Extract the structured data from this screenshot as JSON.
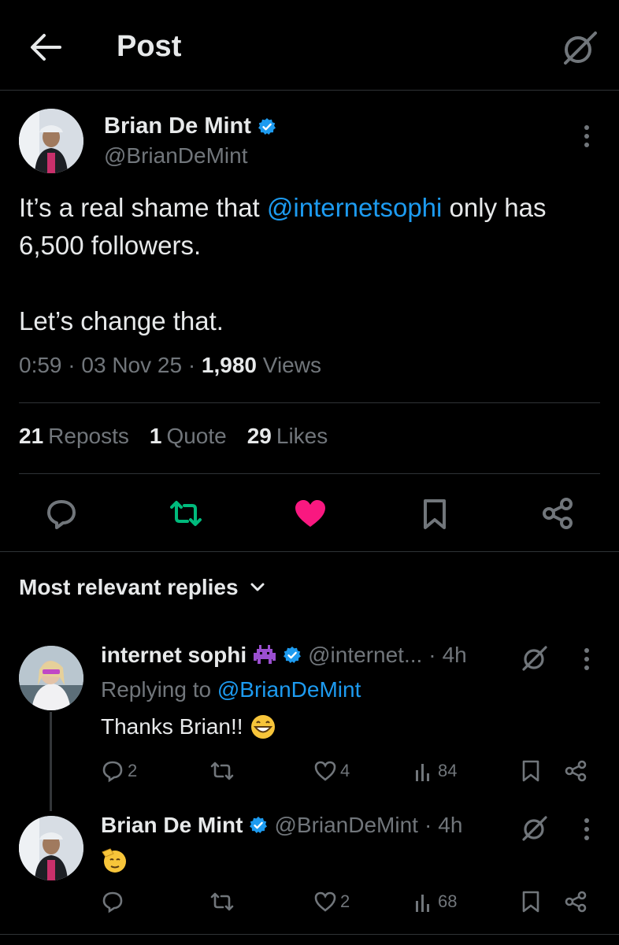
{
  "header": {
    "title": "Post"
  },
  "main_tweet": {
    "author_name": "Brian De Mint",
    "author_handle": "@BrianDeMint",
    "text_part1": "It’s a real shame that ",
    "mention": "@internetsophi",
    "text_part2": " only has 6,500 followers.",
    "text_line3": "Let’s change that.",
    "time": "0:59",
    "date": "03 Nov 25",
    "views_count": "1,980",
    "views_label": "Views",
    "separator": "·"
  },
  "stats": {
    "reposts_count": "21",
    "reposts_label": "Reposts",
    "quotes_count": "1",
    "quotes_label": "Quote",
    "likes_count": "29",
    "likes_label": "Likes"
  },
  "colors": {
    "accent": "#1d9bf0",
    "repost_active": "#00ba7c",
    "like_active": "#f91880",
    "secondary": "#71767b"
  },
  "sort": {
    "label": "Most relevant replies"
  },
  "replies": [
    {
      "author_name": "internet sophi",
      "author_handle": "@internet...",
      "separator": "·",
      "time": "4h",
      "replying_prefix": "Replying to ",
      "replying_to": "@BrianDeMint",
      "text": "Thanks Brian!!",
      "emoji": "grinning-face-emoji",
      "reply_count": "2",
      "repost_count": "",
      "like_count": "4",
      "view_count": "84"
    },
    {
      "author_name": "Brian De Mint",
      "author_handle": "@BrianDeMint",
      "separator": "·",
      "time": "4h",
      "text": "",
      "emoji": "saluting-face-emoji",
      "reply_count": "",
      "repost_count": "",
      "like_count": "2",
      "view_count": "68"
    }
  ]
}
